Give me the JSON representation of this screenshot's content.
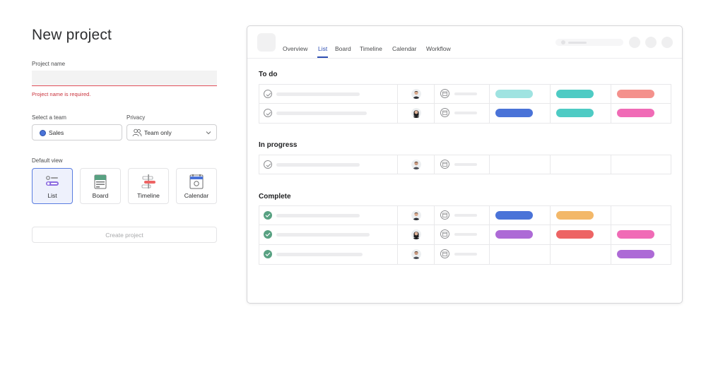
{
  "form": {
    "title": "New project",
    "project_name_label": "Project name",
    "project_name_value": "",
    "project_name_error": "Project name is required.",
    "team_label": "Select a team",
    "team_value": "Sales",
    "team_color": "#4a73d8",
    "privacy_label": "Privacy",
    "privacy_value": "Team only",
    "default_view_label": "Default view",
    "views": [
      {
        "label": "List",
        "icon": "list-view-icon",
        "selected": true
      },
      {
        "label": "Board",
        "icon": "board-view-icon",
        "selected": false
      },
      {
        "label": "Timeline",
        "icon": "timeline-view-icon",
        "selected": false
      },
      {
        "label": "Calendar",
        "icon": "calendar-view-icon",
        "selected": false
      }
    ],
    "create_button": "Create project"
  },
  "preview": {
    "tabs": [
      "Overview",
      "List",
      "Board",
      "Timeline",
      "Calendar",
      "Workflow"
    ],
    "active_tab": "List",
    "sections": [
      {
        "title": "To do"
      },
      {
        "title": "In progress"
      },
      {
        "title": "Complete"
      }
    ],
    "colors": {
      "accent": "#2f4fb3",
      "complete": "#58a182",
      "light_teal": "#9fe3e1",
      "teal": "#4ecbc4",
      "salmon": "#f4918c",
      "blue": "#4a73d8",
      "pink": "#f06bb6",
      "orange": "#f3b869",
      "purple": "#ad6ad6",
      "red": "#ed6464"
    }
  }
}
